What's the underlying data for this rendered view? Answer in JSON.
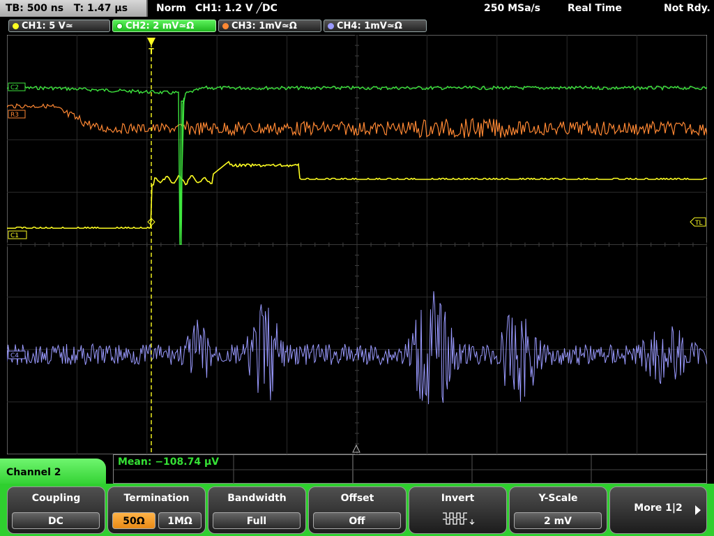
{
  "status": {
    "timebase": "TB: 500 ns",
    "trigger_time": "T: 1.47 µs",
    "mode": "Norm",
    "trigger": "CH1: 1.2 V ╱DC",
    "sample_rate": "250 MSa/s",
    "acq_mode": "Real Time",
    "state": "Not Rdy."
  },
  "channels": [
    {
      "label": "CH1: 5 V≃",
      "color": "#ffff22"
    },
    {
      "label": "CH2: 2 mV≃Ω",
      "color": "#3ee63e"
    },
    {
      "label": "CH3: 1mV≃Ω",
      "color": "#ff8833"
    },
    {
      "label": "CH4: 1mV≃Ω",
      "color": "#9a9aff"
    }
  ],
  "markers": {
    "c2": "C2",
    "c3": "R3",
    "c1": "C1",
    "c4": "C4",
    "trigger_level": "TL",
    "trigger_pos": "T"
  },
  "measurement": {
    "mean": "Mean: −108.74 µV"
  },
  "menu": {
    "title": "Channel 2",
    "coupling_label": "Coupling",
    "coupling_value": "DC",
    "termination_label": "Termination",
    "termination_opt1": "50Ω",
    "termination_opt2": "1MΩ",
    "bandwidth_label": "Bandwidth",
    "bandwidth_value": "Full",
    "offset_label": "Offset",
    "offset_value": "Off",
    "invert_label": "Invert",
    "yscale_label": "Y-Scale",
    "yscale_value": "2 mV",
    "more_label": "More 1|2"
  }
}
